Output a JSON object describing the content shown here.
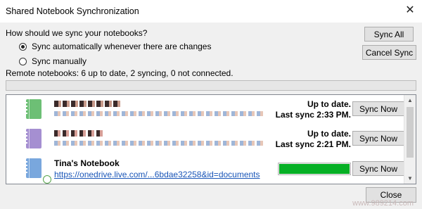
{
  "window": {
    "title": "Shared Notebook Synchronization",
    "close_glyph": "✕"
  },
  "question": "How should we sync your notebooks?",
  "options": {
    "auto": "Sync automatically whenever there are changes",
    "manual": "Sync manually",
    "selected": "auto"
  },
  "buttons": {
    "sync_all": "Sync All",
    "cancel_sync": "Cancel Sync",
    "close": "Close"
  },
  "remote_status": "Remote notebooks: 6 up to date, 2 syncing, 0 not connected.",
  "notebooks": [
    {
      "icon_color": "#6dbf75",
      "status": "Up to date.",
      "last_sync": "Last sync 2:33 PM.",
      "button": "Sync Now"
    },
    {
      "icon_color": "#a58fd1",
      "status": "Up to date.",
      "last_sync": "Last sync 2:21 PM.",
      "button": "Sync Now"
    },
    {
      "icon_color": "#79a7dd",
      "name": "Tina's Notebook",
      "url": "https://onedrive.live.com/...6bdae32258&id=documents",
      "sync_progress": 1.0,
      "button": "Sync Now"
    }
  ],
  "colors": {
    "progress": "#06b025",
    "link": "#1a56b8",
    "default_border": "#5a8fd6"
  },
  "watermark": "www.989214.com"
}
